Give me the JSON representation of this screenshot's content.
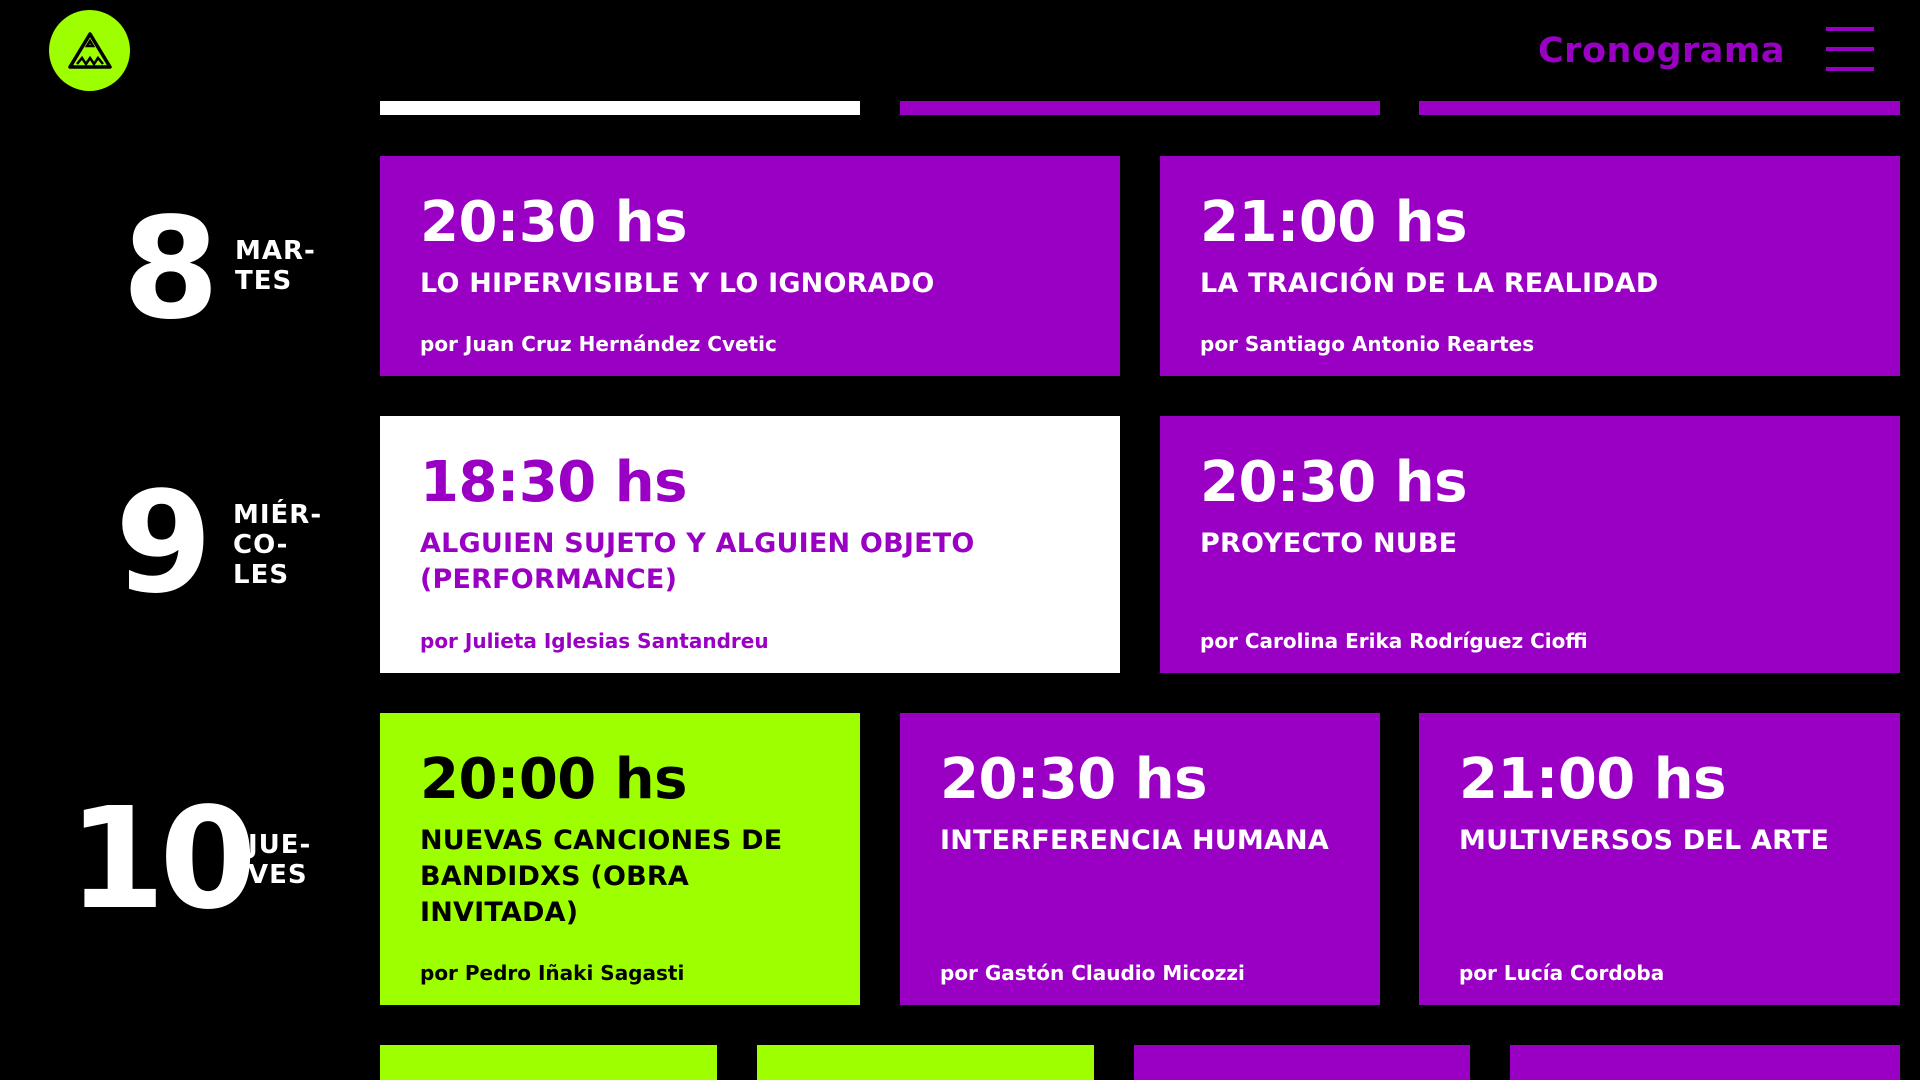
{
  "colors": {
    "purple": "#9900c4",
    "lime": "#9dff00",
    "white": "#ffffff",
    "background": "#000000"
  },
  "header": {
    "logo_icon": "triangle-eye-logo-icon",
    "nav_title": "Cronograma",
    "menu_icon": "hamburger-menu-icon"
  },
  "days": [
    {
      "number": "8",
      "name": "MAR-\nTES",
      "events": [
        {
          "time": "20:30 hs",
          "title": "LO HIPERVISIBLE Y LO IGNORADO",
          "author": "por Juan Cruz Hernández Cvetic",
          "color": "purple"
        },
        {
          "time": "21:00 hs",
          "title": "LA TRAICIÓN DE LA REALIDAD",
          "author": "por Santiago Antonio Reartes",
          "color": "purple"
        }
      ]
    },
    {
      "number": "9",
      "name": "MIÉR-\nCO-\nLES",
      "events": [
        {
          "time": "18:30 hs",
          "title": "ALGUIEN SUJETO Y ALGUIEN OBJETO (PERFORMANCE)",
          "author": "por Julieta Iglesias Santandreu",
          "color": "white"
        },
        {
          "time": "20:30 hs",
          "title": "PROYECTO NUBE",
          "author": "por Carolina Erika Rodríguez Cioffi",
          "color": "purple"
        }
      ]
    },
    {
      "number": "10",
      "name": "JUE-\nVES",
      "events": [
        {
          "time": "20:00 hs",
          "title": "NUEVAS CANCIONES DE BANDIDXS (OBRA INVITADA)",
          "author": "por Pedro Iñaki Sagasti",
          "color": "lime"
        },
        {
          "time": "20:30 hs",
          "title": "INTERFERENCIA HUMANA",
          "author": "por Gastón Claudio Micozzi",
          "color": "purple"
        },
        {
          "time": "21:00 hs",
          "title": "MULTIVERSOS DEL ARTE",
          "author": "por Lucía Cordoba",
          "color": "purple"
        }
      ]
    }
  ]
}
